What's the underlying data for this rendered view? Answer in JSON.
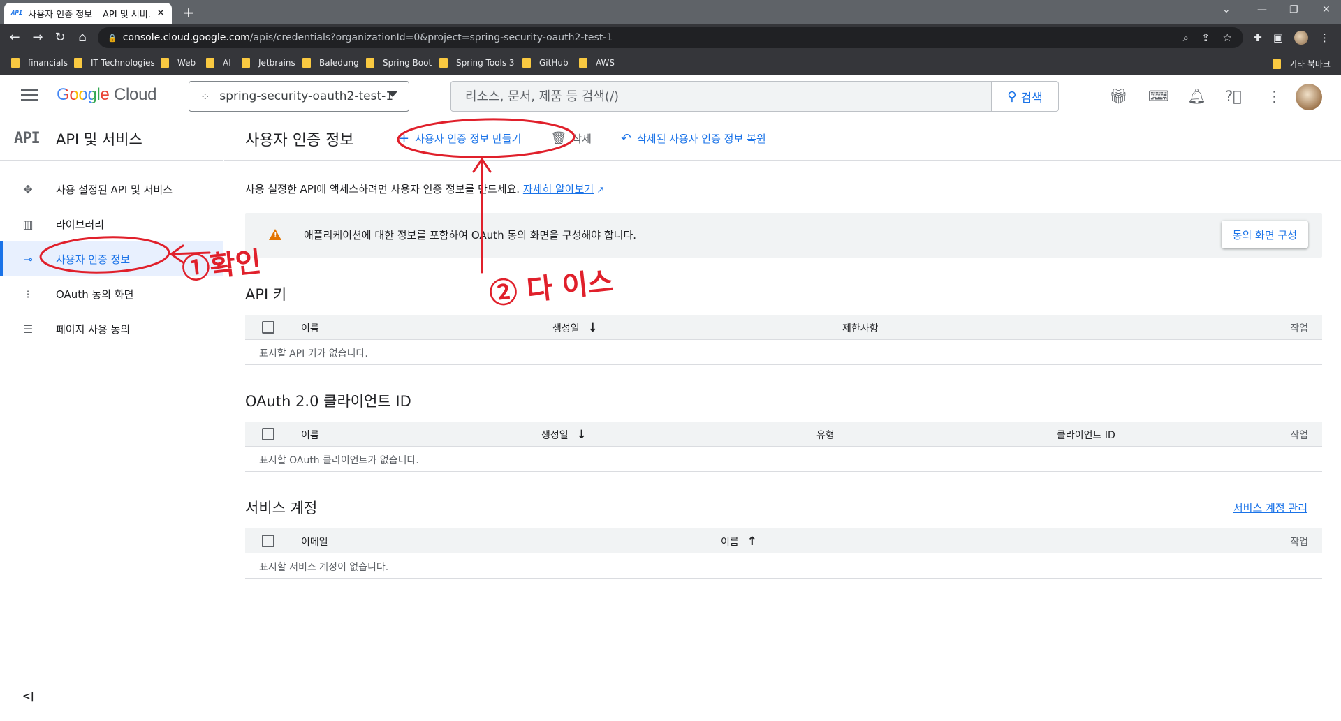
{
  "browser": {
    "tab_title": "사용자 인증 정보 – API 및 서비...",
    "tab_favicon": "API",
    "url_host": "console.cloud.google.com",
    "url_path": "/apis/credentials?organizationId=0&project=spring-security-oauth2-test-1",
    "bookmarks": [
      "financials",
      "IT Technologies",
      "Web",
      "AI",
      "Jetbrains",
      "Baledung",
      "Spring Boot",
      "Spring Tools 3",
      "GitHub",
      "AWS"
    ],
    "other_bookmarks": "기타 북마크"
  },
  "header": {
    "logo_google": "Google",
    "logo_cloud": "Cloud",
    "project": "spring-security-oauth2-test-1",
    "search_placeholder": "리소스, 문서, 제품 등 검색(/)",
    "search_button": "검색"
  },
  "sidebar": {
    "badge": "API",
    "title": "API 및 서비스",
    "items": [
      {
        "label": "사용 설정된 API 및 서비스",
        "icon": "apis-icon"
      },
      {
        "label": "라이브러리",
        "icon": "library-icon"
      },
      {
        "label": "사용자 인증 정보",
        "icon": "key-icon",
        "active": true
      },
      {
        "label": "OAuth 동의 화면",
        "icon": "consent-icon"
      },
      {
        "label": "페이지 사용 동의",
        "icon": "settings-list-icon"
      }
    ],
    "collapse": "<|"
  },
  "main": {
    "title": "사용자 인증 정보",
    "create_label": "사용자 인증 정보 만들기",
    "delete_label": "삭제",
    "restore_label": "삭제된 사용자 인증 정보 복원",
    "intro_text": "사용 설정한 API에 액세스하려면 사용자 인증 정보를 만드세요.",
    "intro_link": "자세히 알아보기",
    "warning_text": "애플리케이션에 대한 정보를 포함하여 OAuth 동의 화면을 구성해야 합니다.",
    "warning_button": "동의 화면 구성",
    "api_keys": {
      "title": "API 키",
      "columns": [
        "이름",
        "생성일",
        "제한사항",
        "작업"
      ],
      "empty": "표시할 API 키가 없습니다."
    },
    "oauth": {
      "title": "OAuth 2.0 클라이언트 ID",
      "columns": [
        "이름",
        "생성일",
        "유형",
        "클라이언트 ID",
        "작업"
      ],
      "empty": "표시할 OAuth 클라이언트가 없습니다."
    },
    "service_accounts": {
      "title": "서비스 계정",
      "manage_link": "서비스 계정 관리",
      "columns": [
        "이메일",
        "이름",
        "작업"
      ],
      "empty": "표시할 서비스 계정이 없습니다."
    }
  },
  "annotations": {
    "note1": "①확인",
    "note2": "② 다 이스"
  }
}
